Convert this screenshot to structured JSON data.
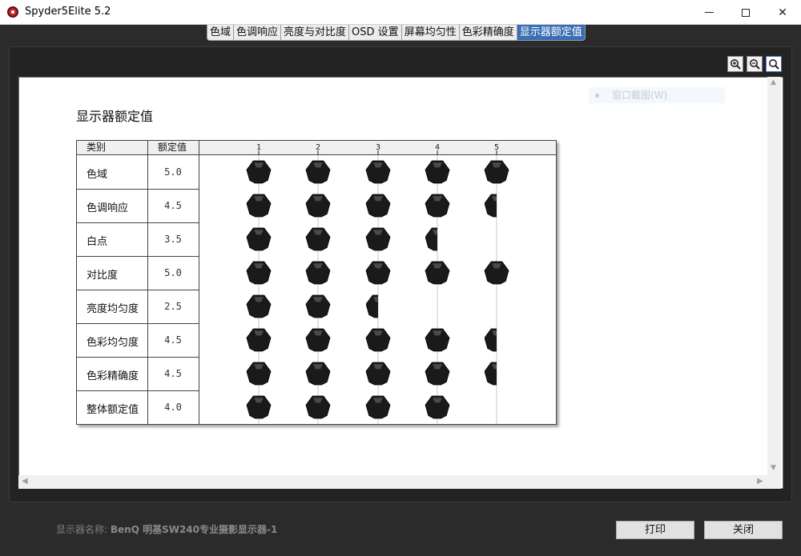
{
  "window": {
    "title": "Spyder5Elite 5.2",
    "minimize_icon": "minimize-icon",
    "maximize_icon": "maximize-icon",
    "close_icon": "close-icon"
  },
  "tabs": [
    {
      "label": "色域",
      "active": false
    },
    {
      "label": "色调响应",
      "active": false
    },
    {
      "label": "亮度与对比度",
      "active": false
    },
    {
      "label": "OSD 设置",
      "active": false
    },
    {
      "label": "屏幕均匀性",
      "active": false
    },
    {
      "label": "色彩精确度",
      "active": false
    },
    {
      "label": "显示器额定值",
      "active": true
    }
  ],
  "toolbar": {
    "icons": [
      "zoom-in-icon",
      "zoom-out-icon",
      "zoom-fit-icon"
    ]
  },
  "report": {
    "copy_hint": "窗口截图(W)",
    "title": "显示器额定值",
    "header_category": "类别",
    "header_value": "额定值",
    "rows": [
      {
        "category": "色域",
        "value": "5.0"
      },
      {
        "category": "色调响应",
        "value": "4.5"
      },
      {
        "category": "白点",
        "value": "3.5"
      },
      {
        "category": "对比度",
        "value": "5.0"
      },
      {
        "category": "亮度均匀度",
        "value": "2.5"
      },
      {
        "category": "色彩均匀度",
        "value": "4.5"
      },
      {
        "category": "色彩精确度",
        "value": "4.5"
      },
      {
        "category": "整体额定值",
        "value": "4.0"
      }
    ]
  },
  "chart_data": {
    "type": "bar",
    "categories": [
      "色域",
      "色调响应",
      "白点",
      "对比度",
      "亮度均匀度",
      "色彩均匀度",
      "色彩精确度",
      "整体额定值"
    ],
    "values": [
      5.0,
      4.5,
      3.5,
      5.0,
      2.5,
      4.5,
      4.5,
      4.0
    ],
    "tick_labels": [
      "1",
      "2",
      "3",
      "4",
      "5"
    ],
    "xlim": [
      0,
      5
    ],
    "mark": "spyder-icon"
  },
  "footer": {
    "display_label": "显示器名称:",
    "display_value": "BenQ 明基SW240专业摄影显示器-1",
    "print_label": "打印",
    "close_label": "关闭"
  },
  "colors": {
    "active_tab": "#3a6fb5",
    "background": "#2b2b2b",
    "icon_fill": "#1a1a1a"
  }
}
